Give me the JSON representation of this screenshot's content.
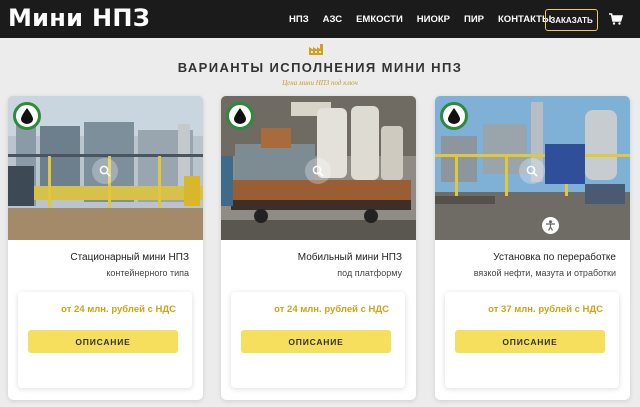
{
  "header": {
    "logo": "Мини НПЗ",
    "nav": [
      "НПЗ",
      "АЗС",
      "ЕМКОСТИ",
      "НИОКР",
      "ПИР",
      "КОНТАКТЫ"
    ],
    "order_label": "ЗАКАЗАТЬ",
    "cart_icon": "cart-icon"
  },
  "section": {
    "icon": "factory-icon",
    "title": "ВАРИАНТЫ ИСПОЛНЕНИЯ МИНИ НПЗ",
    "subtitle": "Цена мини НПЗ под ключ"
  },
  "cards": [
    {
      "title": "Стационарный мини НПЗ",
      "subtitle": "контейнерного типа",
      "price": "от 24 млн. рублей с НДС",
      "button": "ОПИСАНИЕ"
    },
    {
      "title": "Мобильный мини НПЗ",
      "subtitle": "под платформу",
      "price": "от 24 млн. рублей с НДС",
      "button": "ОПИСАНИЕ"
    },
    {
      "title": "Установка по переработке",
      "subtitle": "вязкой нефти, мазута и отработки",
      "price": "от 37 млн. рублей с НДС",
      "button": "ОПИСАНИЕ"
    }
  ],
  "colors": {
    "accent": "#f7df5e",
    "price": "#d4a017",
    "badge_ring": "#2e8b3a",
    "header_bg": "#1b1b1b"
  }
}
